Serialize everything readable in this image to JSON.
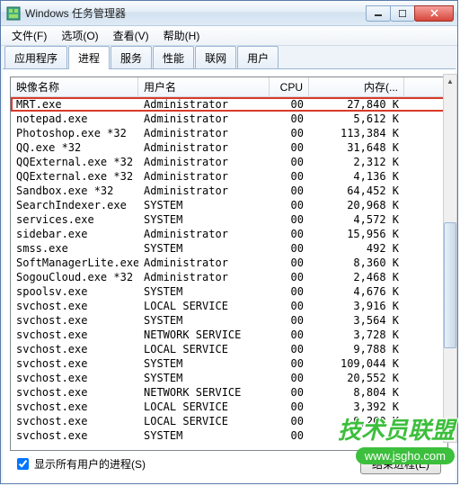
{
  "window": {
    "title": "Windows 任务管理器"
  },
  "menu": {
    "file": "文件(F)",
    "options": "选项(O)",
    "view": "查看(V)",
    "help": "帮助(H)"
  },
  "tabs": {
    "applications": "应用程序",
    "processes": "进程",
    "services": "服务",
    "performance": "性能",
    "networking": "联网",
    "users": "用户"
  },
  "columns": {
    "image": "映像名称",
    "user": "用户名",
    "cpu": "CPU",
    "memory": "内存(..."
  },
  "processes": [
    {
      "name": "MRT.exe",
      "user": "Administrator",
      "cpu": "00",
      "mem": "27,840 K",
      "highlight": true
    },
    {
      "name": "notepad.exe",
      "user": "Administrator",
      "cpu": "00",
      "mem": "5,612 K"
    },
    {
      "name": "Photoshop.exe *32",
      "user": "Administrator",
      "cpu": "00",
      "mem": "113,384 K"
    },
    {
      "name": "QQ.exe *32",
      "user": "Administrator",
      "cpu": "00",
      "mem": "31,648 K"
    },
    {
      "name": "QQExternal.exe *32",
      "user": "Administrator",
      "cpu": "00",
      "mem": "2,312 K"
    },
    {
      "name": "QQExternal.exe *32",
      "user": "Administrator",
      "cpu": "00",
      "mem": "4,136 K"
    },
    {
      "name": "Sandbox.exe *32",
      "user": "Administrator",
      "cpu": "00",
      "mem": "64,452 K"
    },
    {
      "name": "SearchIndexer.exe",
      "user": "SYSTEM",
      "cpu": "00",
      "mem": "20,968 K"
    },
    {
      "name": "services.exe",
      "user": "SYSTEM",
      "cpu": "00",
      "mem": "4,572 K"
    },
    {
      "name": "sidebar.exe",
      "user": "Administrator",
      "cpu": "00",
      "mem": "15,956 K"
    },
    {
      "name": "smss.exe",
      "user": "SYSTEM",
      "cpu": "00",
      "mem": "492 K"
    },
    {
      "name": "SoftManagerLite.exe...",
      "user": "Administrator",
      "cpu": "00",
      "mem": "8,360 K"
    },
    {
      "name": "SogouCloud.exe *32",
      "user": "Administrator",
      "cpu": "00",
      "mem": "2,468 K"
    },
    {
      "name": "spoolsv.exe",
      "user": "SYSTEM",
      "cpu": "00",
      "mem": "4,676 K"
    },
    {
      "name": "svchost.exe",
      "user": "LOCAL SERVICE",
      "cpu": "00",
      "mem": "3,916 K"
    },
    {
      "name": "svchost.exe",
      "user": "SYSTEM",
      "cpu": "00",
      "mem": "3,564 K"
    },
    {
      "name": "svchost.exe",
      "user": "NETWORK SERVICE",
      "cpu": "00",
      "mem": "3,728 K"
    },
    {
      "name": "svchost.exe",
      "user": "LOCAL SERVICE",
      "cpu": "00",
      "mem": "9,788 K"
    },
    {
      "name": "svchost.exe",
      "user": "SYSTEM",
      "cpu": "00",
      "mem": "109,044 K"
    },
    {
      "name": "svchost.exe",
      "user": "SYSTEM",
      "cpu": "00",
      "mem": "20,552 K"
    },
    {
      "name": "svchost.exe",
      "user": "NETWORK SERVICE",
      "cpu": "00",
      "mem": "8,804 K"
    },
    {
      "name": "svchost.exe",
      "user": "LOCAL SERVICE",
      "cpu": "00",
      "mem": "3,392 K"
    },
    {
      "name": "svchost.exe",
      "user": "LOCAL SERVICE",
      "cpu": "00",
      "mem": "9,260 K"
    },
    {
      "name": "svchost.exe",
      "user": "SYSTEM",
      "cpu": "00",
      "mem": ""
    }
  ],
  "footer": {
    "showAll": "显示所有用户的进程(S)",
    "endProcess": "结束进程(E)"
  },
  "watermark": {
    "main": "技术员联盟",
    "url": "www.jsgho.com"
  }
}
